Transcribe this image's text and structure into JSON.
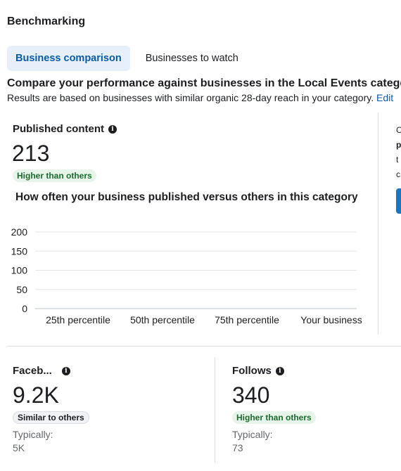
{
  "section_title": "Benchmarking",
  "tabs": [
    {
      "label": "Business comparison",
      "active": true
    },
    {
      "label": "Businesses to watch",
      "active": false
    }
  ],
  "headline": "Compare your performance against businesses in the Local Events category",
  "subtext": "Results are based on businesses with similar organic 28-day reach in your category.",
  "edit_link": "Edit",
  "published": {
    "label": "Published content",
    "value": "213",
    "badge": "Higher than others",
    "badge_color": "#1b6b2e",
    "chart_title": "How often your business published versus others in this category"
  },
  "chart_data": {
    "type": "bar",
    "categories": [
      "25th percentile",
      "50th percentile",
      "75th percentile",
      "Your business"
    ],
    "values": [
      null,
      null,
      null,
      null
    ],
    "yticks": [
      200,
      150,
      100,
      50,
      0
    ],
    "ylim": [
      0,
      200
    ],
    "grid": true
  },
  "side_panel": {
    "stubs": [
      "C",
      "p",
      "t",
      "c"
    ]
  },
  "facebook": {
    "label": "Faceb...",
    "value": "9.2K",
    "badge": "Similar to others",
    "typically_label": "Typically:",
    "typically_value": "5K"
  },
  "follows": {
    "label": "Follows",
    "value": "340",
    "badge": "Higher than others",
    "typically_label": "Typically:",
    "typically_value": "73"
  },
  "colors": {
    "accent": "#0b5aa6",
    "tab_active_bg": "#e7f0fa",
    "positive_badge_bg": "#e7f4ea",
    "button_blue": "#1877c3"
  }
}
